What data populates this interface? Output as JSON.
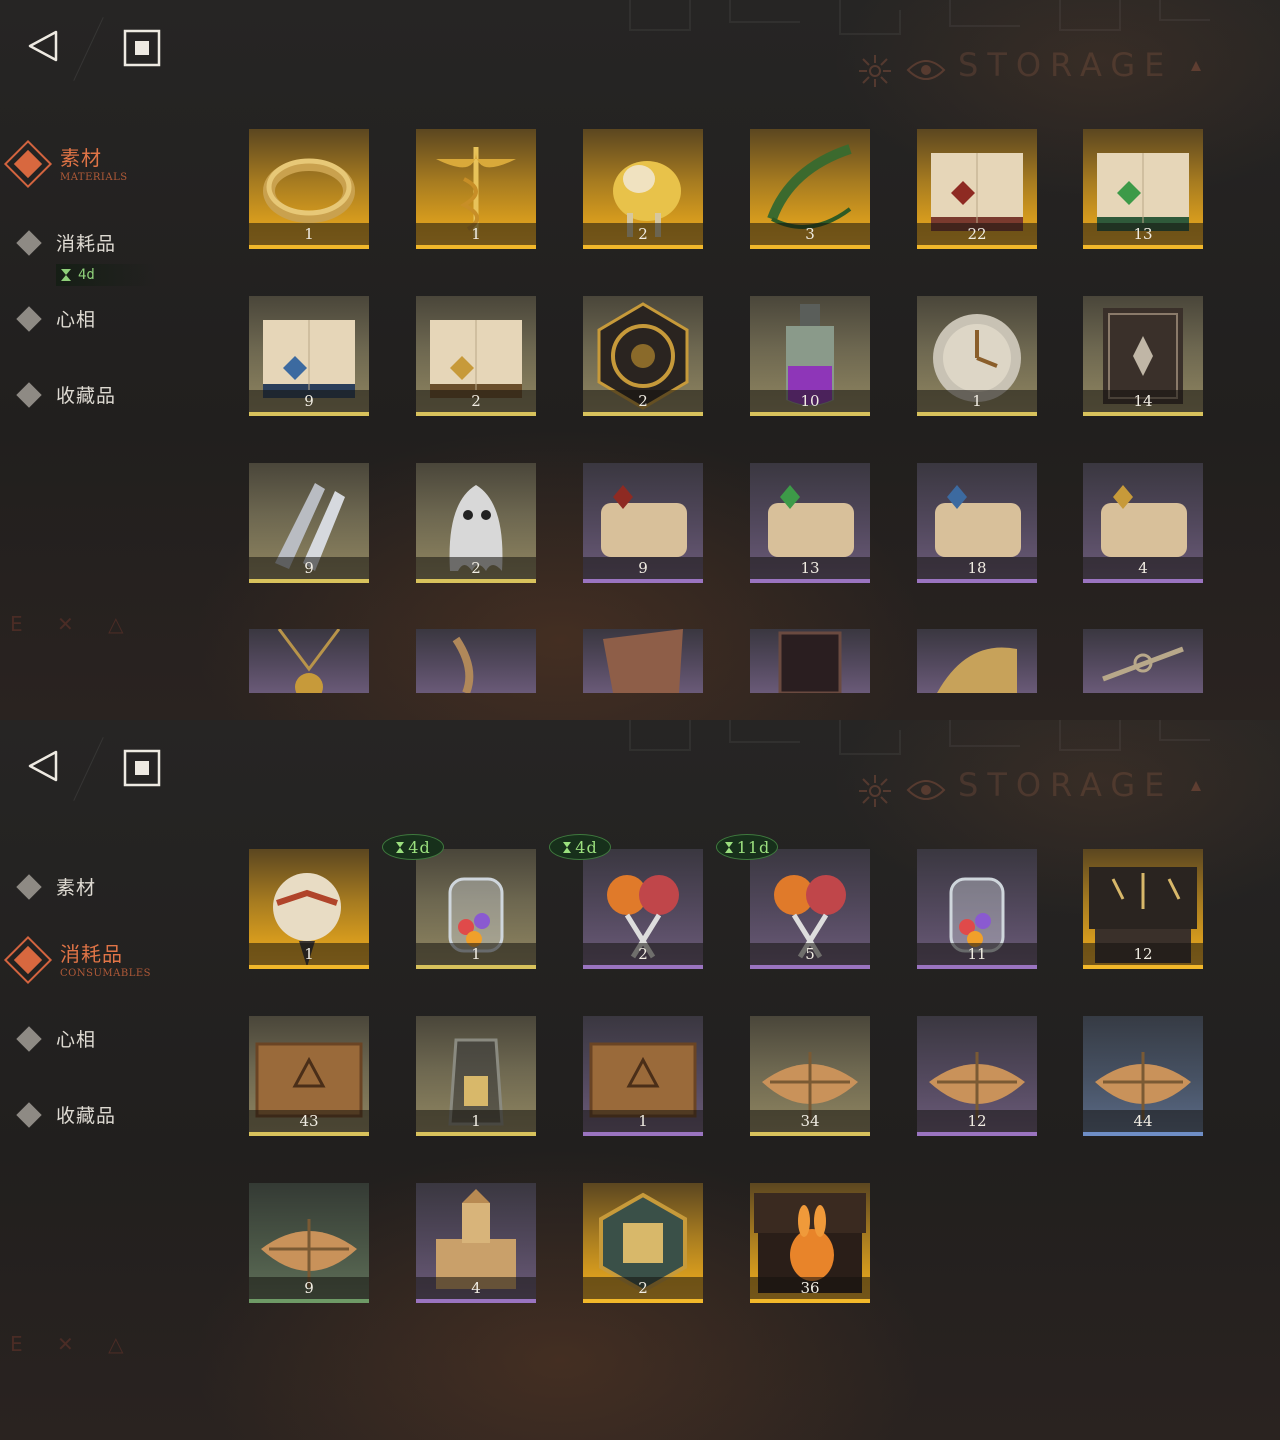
{
  "top": {
    "watermark": "STORAGE",
    "nav": [
      {
        "label": "素材",
        "sub": "MATERIALS",
        "active": true
      },
      {
        "label": "消耗品",
        "active": false,
        "timer": "4d"
      },
      {
        "label": "心相",
        "active": false
      },
      {
        "label": "收藏品",
        "active": false
      }
    ],
    "items": [
      {
        "count": "1",
        "rarity": "gold",
        "icon": "golden-ring-icon"
      },
      {
        "count": "1",
        "rarity": "gold",
        "icon": "caduceus-icon"
      },
      {
        "count": "2",
        "rarity": "gold",
        "icon": "golden-sheep-icon"
      },
      {
        "count": "3",
        "rarity": "gold",
        "icon": "laurel-wreath-icon"
      },
      {
        "count": "22",
        "rarity": "gold",
        "icon": "red-tome-icon"
      },
      {
        "count": "13",
        "rarity": "gold",
        "icon": "green-tome-icon"
      },
      {
        "count": "9",
        "rarity": "yellow",
        "icon": "blue-tome-icon"
      },
      {
        "count": "2",
        "rarity": "yellow",
        "icon": "gold-tome-icon"
      },
      {
        "count": "2",
        "rarity": "yellow",
        "icon": "clockwork-icon"
      },
      {
        "count": "10",
        "rarity": "yellow",
        "icon": "potion-bottle-icon"
      },
      {
        "count": "1",
        "rarity": "yellow",
        "icon": "pocket-watch-icon"
      },
      {
        "count": "14",
        "rarity": "yellow",
        "icon": "dark-grimoire-icon"
      },
      {
        "count": "9",
        "rarity": "yellow",
        "icon": "silver-bullets-icon"
      },
      {
        "count": "2",
        "rarity": "yellow",
        "icon": "ghost-icon"
      },
      {
        "count": "9",
        "rarity": "purple",
        "icon": "red-scroll-icon"
      },
      {
        "count": "13",
        "rarity": "purple",
        "icon": "green-scroll-icon"
      },
      {
        "count": "18",
        "rarity": "purple",
        "icon": "blue-scroll-icon"
      },
      {
        "count": "4",
        "rarity": "purple",
        "icon": "gold-scroll-icon"
      },
      {
        "count": "",
        "rarity": "purple",
        "icon": "amulet-icon"
      },
      {
        "count": "",
        "rarity": "purple",
        "icon": "chain-icon"
      },
      {
        "count": "",
        "rarity": "purple",
        "icon": "stone-tablet-icon"
      },
      {
        "count": "",
        "rarity": "purple",
        "icon": "mirror-box-icon"
      },
      {
        "count": "",
        "rarity": "purple",
        "icon": "mechanical-wing-icon"
      },
      {
        "count": "",
        "rarity": "purple",
        "icon": "winged-key-icon"
      }
    ]
  },
  "bottom": {
    "watermark": "STORAGE",
    "nav": [
      {
        "label": "素材",
        "active": false
      },
      {
        "label": "消耗品",
        "sub": "CONSUMABLES",
        "active": true
      },
      {
        "label": "心相",
        "active": false
      },
      {
        "label": "收藏品",
        "active": false
      }
    ],
    "items": [
      {
        "count": "1",
        "rarity": "gold",
        "icon": "tribal-ornament-icon",
        "timer": ""
      },
      {
        "count": "1",
        "rarity": "yellow",
        "icon": "candy-jar-icon",
        "timer": "4d"
      },
      {
        "count": "2",
        "rarity": "purple",
        "icon": "lollipops-icon",
        "timer": "4d"
      },
      {
        "count": "5",
        "rarity": "purple",
        "icon": "lollipops-icon",
        "timer": "11d"
      },
      {
        "count": "11",
        "rarity": "purple",
        "icon": "candy-jar-icon",
        "timer": ""
      },
      {
        "count": "12",
        "rarity": "gold",
        "icon": "rune-chest-icon",
        "timer": ""
      },
      {
        "count": "43",
        "rarity": "yellow",
        "icon": "wooden-crate-icon",
        "timer": ""
      },
      {
        "count": "1",
        "rarity": "yellow",
        "icon": "message-bottle-icon",
        "timer": ""
      },
      {
        "count": "1",
        "rarity": "purple",
        "icon": "wooden-crate-icon",
        "timer": ""
      },
      {
        "count": "34",
        "rarity": "yellow",
        "icon": "parcel-icon",
        "timer": ""
      },
      {
        "count": "12",
        "rarity": "purple",
        "icon": "parcel-icon",
        "timer": ""
      },
      {
        "count": "44",
        "rarity": "blue",
        "icon": "parcel-icon",
        "timer": ""
      },
      {
        "count": "9",
        "rarity": "green",
        "icon": "parcel-icon",
        "timer": ""
      },
      {
        "count": "4",
        "rarity": "purple",
        "icon": "sand-castle-icon",
        "timer": ""
      },
      {
        "count": "2",
        "rarity": "gold",
        "icon": "puzzle-tile-icon",
        "timer": ""
      },
      {
        "count": "36",
        "rarity": "gold",
        "icon": "rabbit-box-icon",
        "timer": ""
      }
    ]
  }
}
